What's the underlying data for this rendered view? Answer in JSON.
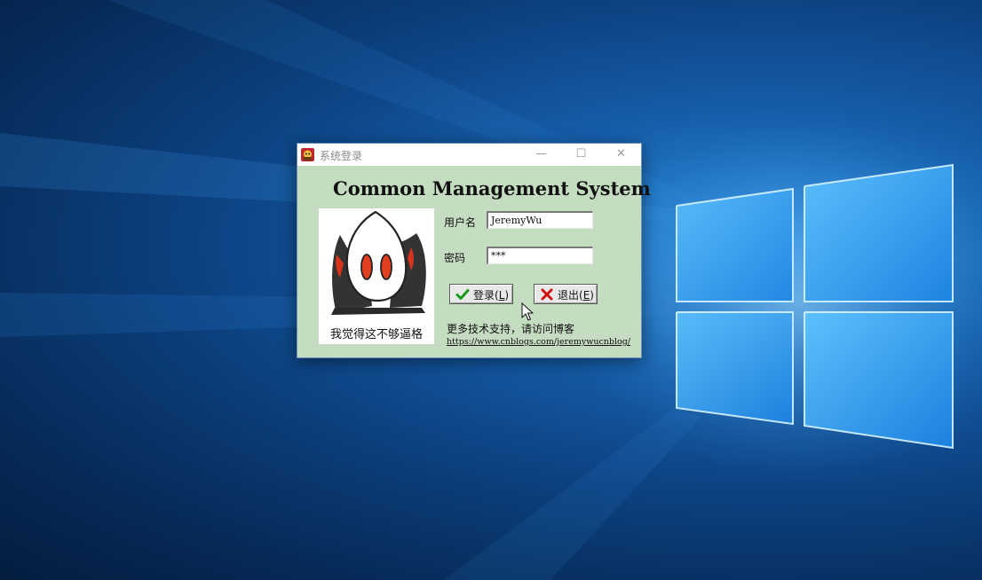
{
  "window": {
    "title": "系统登录",
    "minimize_glyph": "—",
    "maximize_glyph": "☐",
    "close_glyph": "✕"
  },
  "app": {
    "heading": "Common Management System"
  },
  "avatar": {
    "caption": "我觉得这不够逼格"
  },
  "form": {
    "username_label": "用户名",
    "username_value": "JeremyWu",
    "password_label": "密码",
    "password_value": "***"
  },
  "buttons": {
    "login_label": "登录(",
    "login_key": "L",
    "login_suffix": ")",
    "exit_label": "退出(",
    "exit_key": "E",
    "exit_suffix": ")"
  },
  "footer": {
    "support_text": "更多技术支持，请访问博客",
    "blog_url": "https://www.cnblogs.com/jeremywucnblog/"
  },
  "colors": {
    "dialog_background": "#c4dcc0",
    "login_check": "#1a9a1a",
    "exit_cross": "#d01010"
  },
  "icons": {
    "app_icon": "app-icon",
    "login_icon": "check-icon",
    "exit_icon": "cross-icon",
    "cursor": "mouse-pointer-icon"
  }
}
